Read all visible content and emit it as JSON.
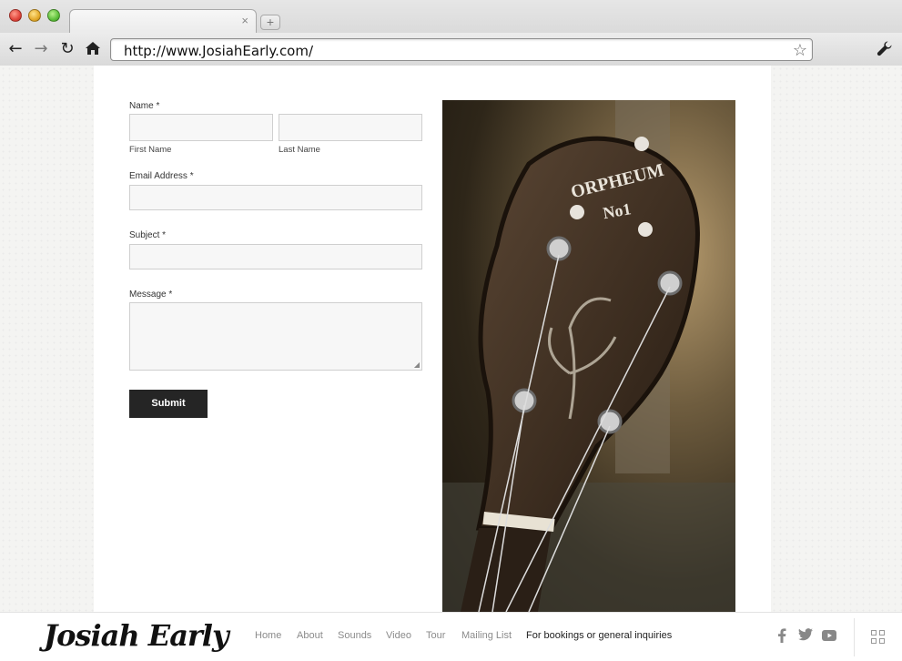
{
  "browser": {
    "url": "http://www.JosiahEarly.com/",
    "tab_close": "×",
    "new_tab": "+"
  },
  "form": {
    "name_label": "Name *",
    "first_name_label": "First Name",
    "last_name_label": "Last Name",
    "email_label": "Email Address *",
    "subject_label": "Subject *",
    "message_label": "Message *",
    "first_name_value": "",
    "last_name_value": "",
    "email_value": "",
    "subject_value": "",
    "message_value": "",
    "submit_label": "Submit"
  },
  "photo": {
    "headstock_text_line1": "ORPHEUM",
    "headstock_text_line2": "No1"
  },
  "footer": {
    "logo": "Josiah Early",
    "nav": [
      "Home",
      "About",
      "Sounds",
      "Video",
      "Tour",
      "Mailing List",
      "For bookings or general inquiries"
    ],
    "social_icons": [
      "facebook-icon",
      "twitter-icon",
      "youtube-icon"
    ],
    "menu_icon": "grid-icon"
  }
}
